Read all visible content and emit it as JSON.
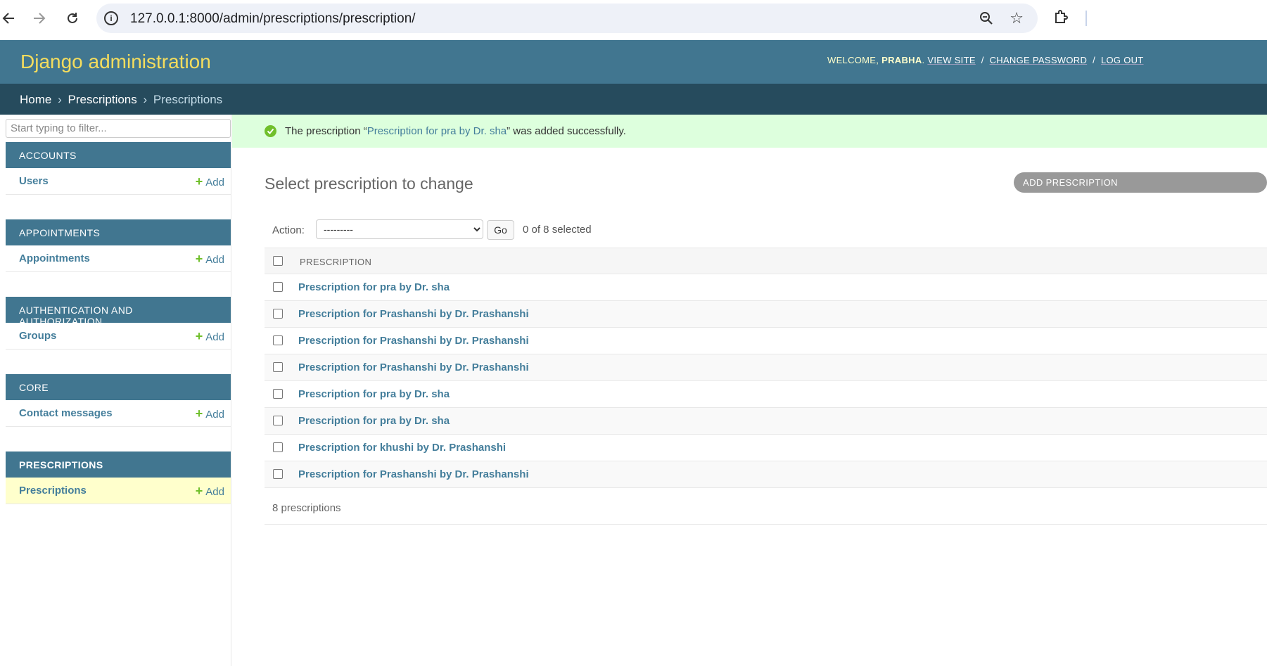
{
  "browser": {
    "url": "127.0.0.1:8000/admin/prescriptions/prescription/"
  },
  "header": {
    "branding": "Django administration",
    "welcome": "WELCOME,",
    "username": "PRABHA",
    "view_site": "VIEW SITE",
    "change_password": "CHANGE PASSWORD",
    "log_out": "LOG OUT",
    "separator": "/"
  },
  "breadcrumbs": {
    "home": "Home",
    "app": "Prescriptions",
    "current": "Prescriptions",
    "arrow": "›"
  },
  "sidebar": {
    "filter_placeholder": "Start typing to filter...",
    "modules": [
      {
        "caption": "ACCOUNTS",
        "models": [
          {
            "name": "Users",
            "add": "Add"
          }
        ]
      },
      {
        "caption": "APPOINTMENTS",
        "models": [
          {
            "name": "Appointments",
            "add": "Add"
          }
        ]
      },
      {
        "caption": "AUTHENTICATION AND AUTHORIZATION",
        "models": [
          {
            "name": "Groups",
            "add": "Add"
          }
        ]
      },
      {
        "caption": "CORE",
        "models": [
          {
            "name": "Contact messages",
            "add": "Add"
          }
        ]
      },
      {
        "caption": "PRESCRIPTIONS",
        "models": [
          {
            "name": "Prescriptions",
            "add": "Add"
          }
        ]
      }
    ],
    "plus": "+"
  },
  "message": {
    "prefix": "The prescription “",
    "link": "Prescription for pra by Dr. sha",
    "suffix": "” was added successfully."
  },
  "main": {
    "title": "Select prescription to change",
    "add_button": "ADD PRESCRIPTION",
    "action_label": "Action:",
    "action_selected": "---------",
    "go": "Go",
    "counter": "0 of 8 selected",
    "column_header": "PRESCRIPTION",
    "rows": [
      "Prescription for pra by Dr. sha",
      "Prescription for Prashanshi by Dr. Prashanshi",
      "Prescription for Prashanshi by Dr. Prashanshi",
      "Prescription for Prashanshi by Dr. Prashanshi",
      "Prescription for pra by Dr. sha",
      "Prescription for pra by Dr. sha",
      "Prescription for khushi by Dr. Prashanshi",
      "Prescription for Prashanshi by Dr. Prashanshi"
    ],
    "paginator": "8 prescriptions"
  },
  "colors": {
    "header": "#417690",
    "breadcrumbs": "#264b5d",
    "branding": "#f5dd5d",
    "link": "#447e9b",
    "success": "#dfd",
    "add_plus": "#70bf2b"
  }
}
